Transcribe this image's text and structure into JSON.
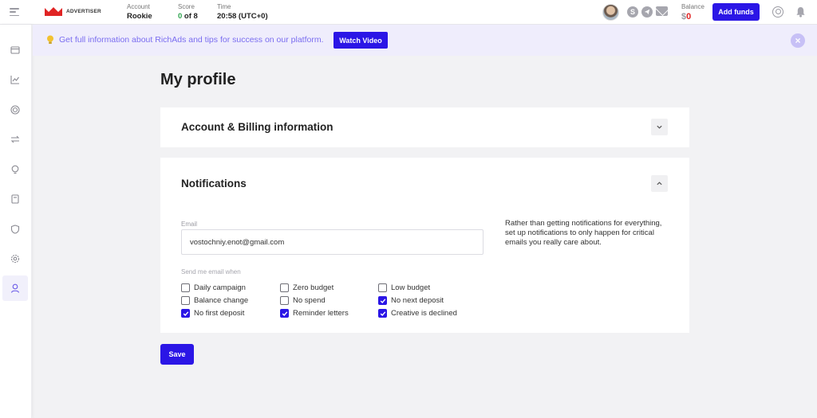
{
  "header": {
    "logo_text": "ADVERTISER",
    "account_label": "Account",
    "account_value": "Rookie",
    "score_label": "Score",
    "score_current": "0",
    "score_rest": " of 8",
    "time_label": "Time",
    "time_value": "20:58 (UTC+0)",
    "balance_label": "Balance",
    "balance_currency": "$",
    "balance_value": "0",
    "add_funds_label": "Add funds"
  },
  "banner": {
    "text": "Get full information about RichAds and tips for success on our platform.",
    "button_label": "Watch Video",
    "close_glyph": "×"
  },
  "sidebar": {
    "items": [
      {
        "icon": "campaigns-icon"
      },
      {
        "icon": "statistics-icon"
      },
      {
        "icon": "target-icon"
      },
      {
        "icon": "transfer-icon"
      },
      {
        "icon": "lightbulb-icon"
      },
      {
        "icon": "book-icon"
      },
      {
        "icon": "shield-icon"
      },
      {
        "icon": "gear-icon"
      },
      {
        "icon": "user-icon",
        "active": true
      }
    ]
  },
  "page": {
    "title": "My profile"
  },
  "account_section": {
    "title": "Account & Billing information"
  },
  "notifications": {
    "title": "Notifications",
    "email_label": "Email",
    "email_value": "vostochniy.enot@gmail.com",
    "help_text": "Rather than getting notifications for everything, set up notifications to only happen for critical emails you really care about.",
    "send_label": "Send me email when",
    "options": [
      {
        "label": "Daily campaign",
        "checked": false
      },
      {
        "label": "Zero budget",
        "checked": false
      },
      {
        "label": "Low budget",
        "checked": false
      },
      {
        "label": "Balance change",
        "checked": false
      },
      {
        "label": "No spend",
        "checked": false
      },
      {
        "label": "No next deposit",
        "checked": true
      },
      {
        "label": "No first deposit",
        "checked": true
      },
      {
        "label": "Reminder letters",
        "checked": true
      },
      {
        "label": "Creative is declined",
        "checked": true
      }
    ]
  },
  "actions": {
    "save_label": "Save"
  },
  "colors": {
    "accent": "#2b16e6",
    "score_green": "#2ea44f",
    "balance_red": "#e02424",
    "banner_bg": "#efedfc",
    "banner_text": "#7a6df0"
  }
}
